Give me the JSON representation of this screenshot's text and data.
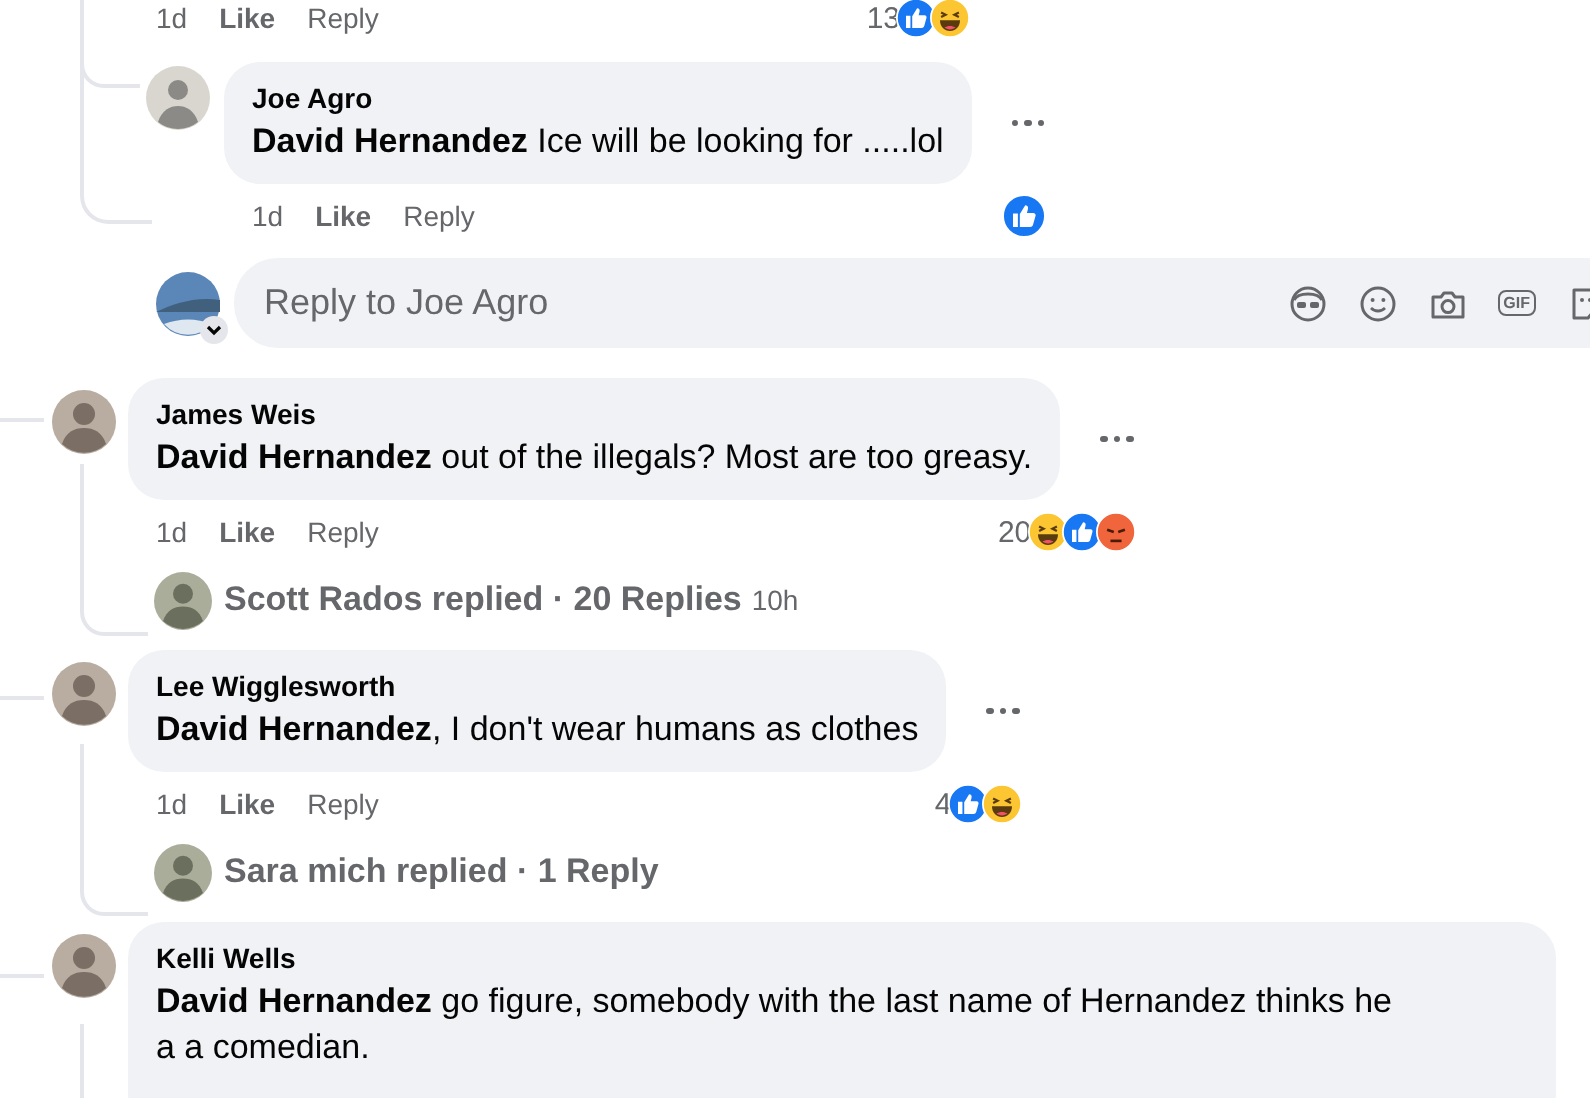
{
  "top_actions": {
    "time": "1d",
    "like": "Like",
    "reply": "Reply",
    "reaction_count": "13",
    "reactions": [
      {
        "kind": "like"
      },
      {
        "kind": "haha"
      }
    ]
  },
  "reply": {
    "author": "Joe Agro",
    "text": "**David Hernandez** Ice will be looking for .....lol",
    "time": "1d",
    "like": "Like",
    "reply": "Reply",
    "reactions": [
      {
        "kind": "like"
      }
    ]
  },
  "composer": {
    "placeholder": "Reply to Joe Agro",
    "gif": "GIF"
  },
  "comments": [
    {
      "author": "James Weis",
      "text": "**David Hernandez** out of the illegals? Most are too greasy.",
      "time": "1d",
      "like": "Like",
      "reply": "Reply",
      "reaction_count": "20",
      "reactions": [
        {
          "kind": "haha"
        },
        {
          "kind": "like"
        },
        {
          "kind": "angry"
        }
      ],
      "replies": {
        "text": "Scott Rados replied · 20 Replies",
        "age": "10h"
      }
    },
    {
      "author": "Lee Wigglesworth",
      "text": "**David Hernandez**, I don't wear humans as clothes",
      "time": "1d",
      "like": "Like",
      "reply": "Reply",
      "reaction_count": "4",
      "reactions": [
        {
          "kind": "like"
        },
        {
          "kind": "haha"
        }
      ],
      "replies": {
        "text": "Sara mich replied · 1 Reply"
      }
    },
    {
      "author": "Kelli Wells",
      "text": "**David Hernandez** go figure, somebody with the last name of Hernandez thinks he a a comedian."
    }
  ]
}
